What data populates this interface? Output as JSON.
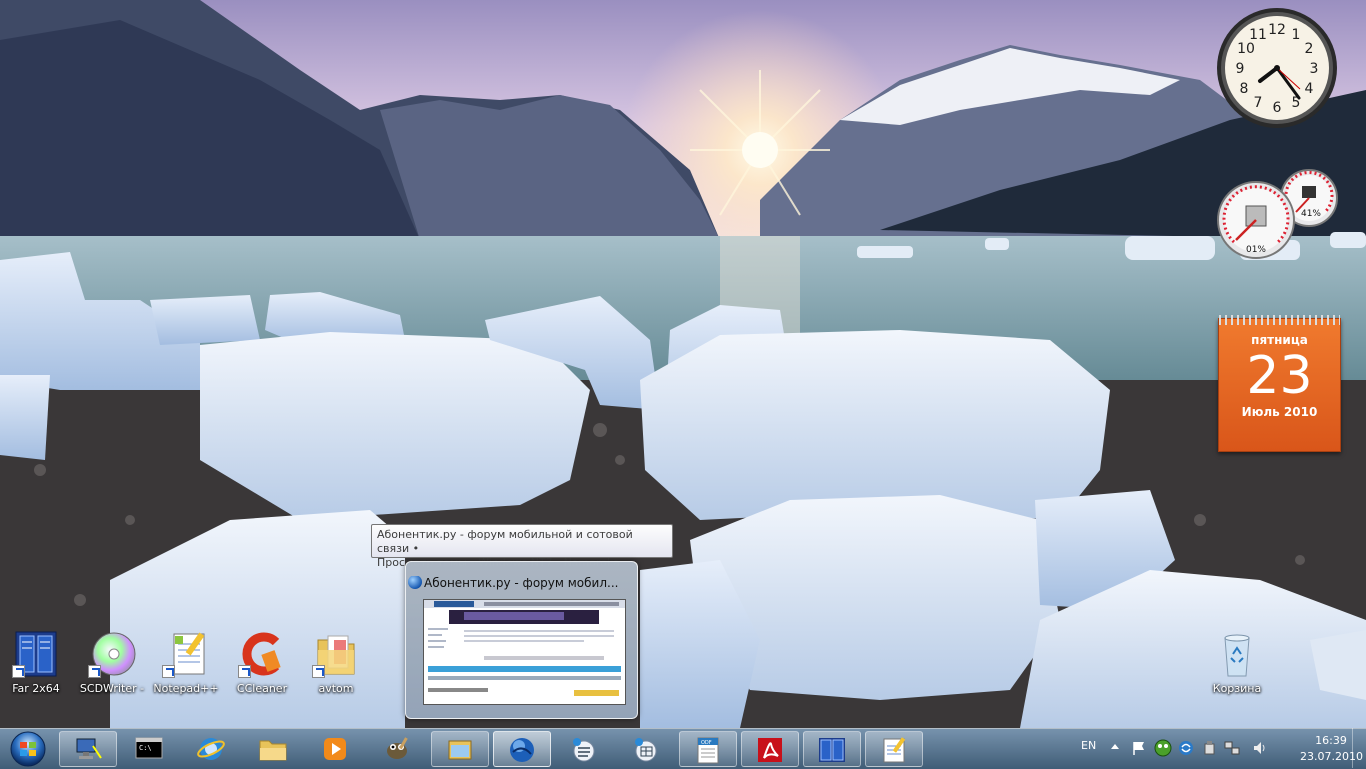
{
  "desktop": {
    "icons": [
      {
        "label": "Far 2x64",
        "icon": "far-manager-icon"
      },
      {
        "label": "SCDWriter -",
        "icon": "cd-disc-icon"
      },
      {
        "label": "Notepad++",
        "icon": "notepad-icon"
      },
      {
        "label": "CCleaner",
        "icon": "ccleaner-icon"
      },
      {
        "label": "avtom",
        "icon": "folder-icon"
      }
    ],
    "recycle_bin": {
      "label": "Корзина",
      "icon": "recycle-bin-icon"
    }
  },
  "gadgets": {
    "clock": {
      "numbers": [
        "12",
        "1",
        "2",
        "3",
        "4",
        "5",
        "6",
        "7",
        "8",
        "9",
        "10",
        "11"
      ]
    },
    "cpu_meter": {
      "cpu_percent": "01%",
      "memory_percent": "41%"
    },
    "calendar": {
      "weekday": "пятница",
      "day": "23",
      "month": "Июль 2010"
    }
  },
  "tooltip": {
    "line1": "Абонентик.ру - форум мобильной и сотовой связи •",
    "line2": "Просмотр темы - Windows NT7 - Namoroka"
  },
  "thumbnail": {
    "title": "Абонентик.ру - форум мобил..."
  },
  "taskbar": {
    "buttons": [
      {
        "icon": "network-pc-icon",
        "state": "open"
      },
      {
        "icon": "cmd-icon",
        "state": "normal"
      },
      {
        "icon": "ie-icon",
        "state": "normal"
      },
      {
        "icon": "explorer-folder-icon",
        "state": "normal"
      },
      {
        "icon": "media-player-icon",
        "state": "normal"
      },
      {
        "icon": "gimp-icon",
        "state": "normal"
      },
      {
        "icon": "window-icon",
        "state": "open"
      },
      {
        "icon": "browser-globe-icon",
        "state": "active"
      },
      {
        "icon": "list-app-icon",
        "state": "normal"
      },
      {
        "icon": "table-app-icon",
        "state": "normal"
      },
      {
        "icon": "odf-document-icon",
        "state": "open"
      },
      {
        "icon": "acrobat-icon",
        "state": "open"
      },
      {
        "icon": "far-manager-icon",
        "state": "open"
      },
      {
        "icon": "notepad-icon",
        "state": "open"
      }
    ],
    "tray": {
      "language": "EN",
      "time": "16:39",
      "date": "23.07.2010"
    }
  },
  "colors": {
    "calendar_orange": "#e8641f",
    "taskbar": "#5a7f98"
  }
}
